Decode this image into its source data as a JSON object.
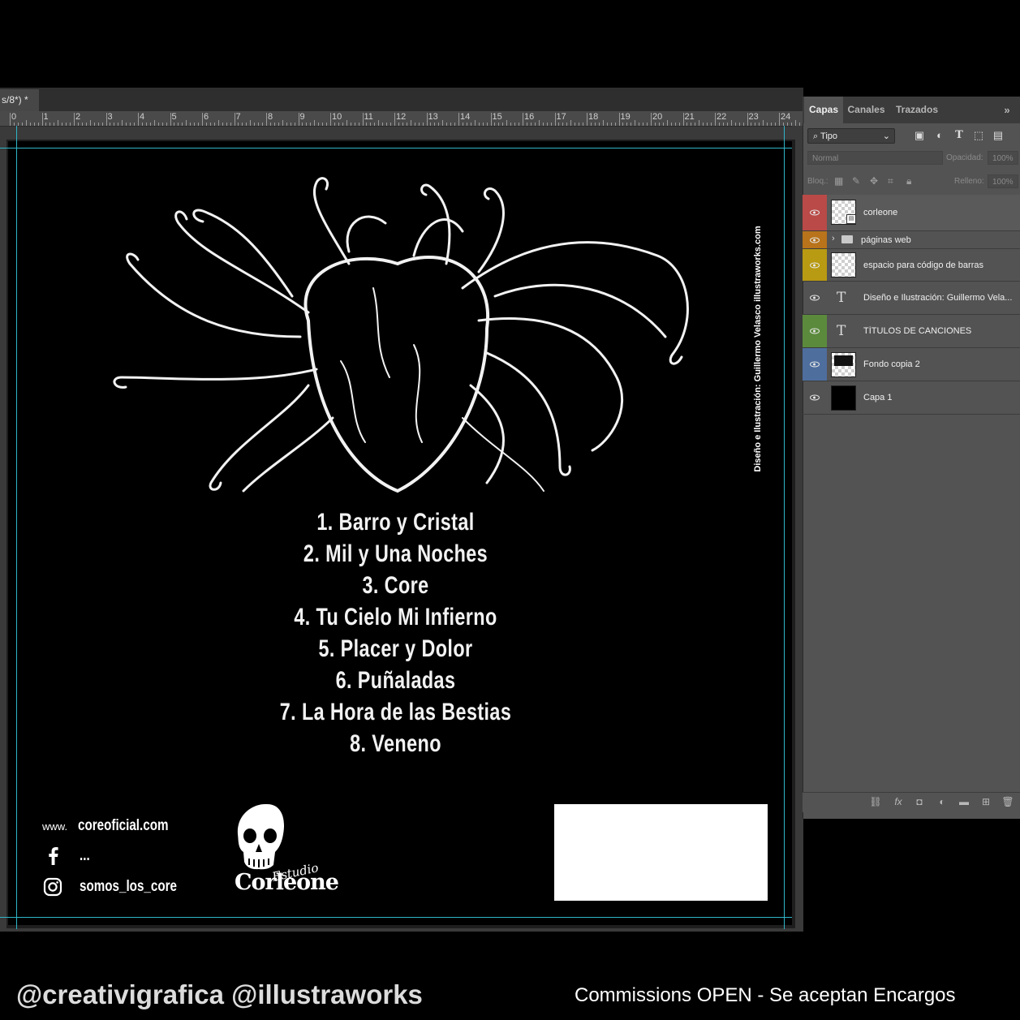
{
  "document": {
    "tab_title": "s/8*) *"
  },
  "ruler": {
    "labels": [
      "0",
      "1",
      "2",
      "3",
      "4",
      "5",
      "6",
      "7",
      "8",
      "9",
      "10",
      "11",
      "12",
      "13",
      "14",
      "15",
      "16",
      "17",
      "18",
      "19",
      "20",
      "21",
      "22",
      "23",
      "24"
    ]
  },
  "artwork": {
    "songs": [
      "1. Barro y Cristal",
      "2. Mil y Una Noches",
      "3. Core",
      "4. Tu Cielo Mi Infierno",
      "5. Placer y Dolor",
      "6. Puñaladas",
      "7. La Hora de las Bestias",
      "8. Veneno"
    ],
    "credit": "Diseño e Ilustración: Guillermo Velasco illustraworks.com",
    "contacts": {
      "www_prefix": "www.",
      "website": "coreoficial.com",
      "facebook": "...",
      "instagram": "somos_los_core"
    },
    "studio_logo": {
      "word": "Estudio",
      "name": "Corleone"
    }
  },
  "layers_panel": {
    "tabs": [
      "Capas",
      "Canales",
      "Trazados"
    ],
    "active_tab": "Capas",
    "filter_kind": "Tipo",
    "blend_mode": "Normal",
    "opacity_label": "Opacidad:",
    "opacity_value": "100%",
    "lock_label": "Bloq.:",
    "fill_label": "Relleno:",
    "fill_value": "100%",
    "layers": [
      {
        "name": "corleone",
        "type": "smart-object",
        "tag_color": "#b94a48"
      },
      {
        "name": "páginas web",
        "type": "group",
        "tag_color": "#b8731b"
      },
      {
        "name": "espacio para código de barras",
        "type": "pixel",
        "tag_color": "#b89a13"
      },
      {
        "name": "Diseño e Ilustración: Guillermo Vela...",
        "type": "text",
        "tag_color": ""
      },
      {
        "name": "TÍTULOS DE CANCIONES",
        "type": "text",
        "tag_color": "#5b8a3c"
      },
      {
        "name": "Fondo copia 2",
        "type": "pixel",
        "tag_color": "#4e6e9e"
      },
      {
        "name": "Capa 1",
        "type": "fill-black",
        "tag_color": ""
      }
    ]
  },
  "captions": {
    "left": "@creativigrafica @illustraworks",
    "right": "Commissions OPEN - Se aceptan Encargos"
  },
  "colors": {
    "guide": "#2fb5c7",
    "panel_bg": "#535353",
    "canvas_bg": "#000000"
  }
}
